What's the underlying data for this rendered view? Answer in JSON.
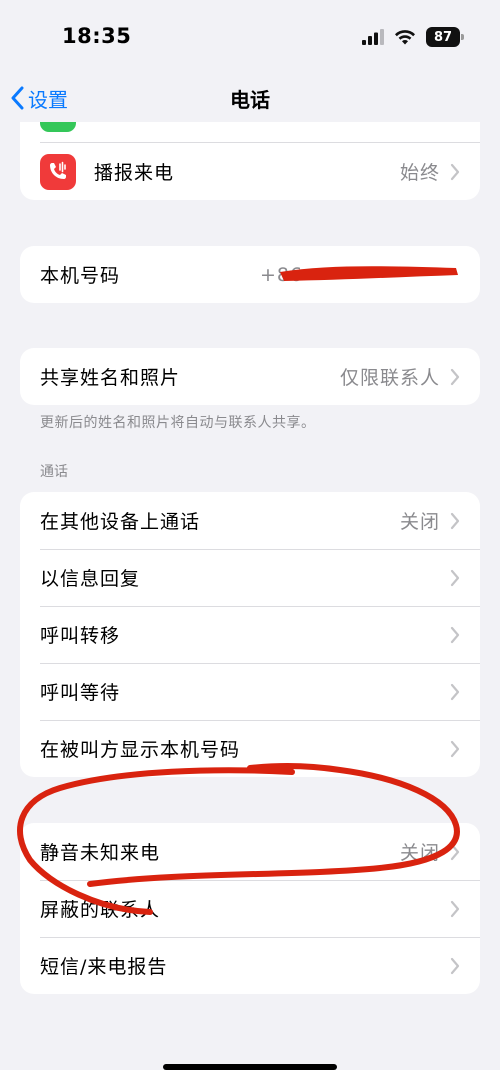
{
  "status": {
    "time": "18:35",
    "battery": "87"
  },
  "nav": {
    "back_label": "设置",
    "title": "电话"
  },
  "top_card": {
    "announce_label": "播报来电",
    "announce_value": "始终"
  },
  "number_card": {
    "label": "本机号码",
    "value": "+86"
  },
  "share_card": {
    "label": "共享姓名和照片",
    "value": "仅限联系人",
    "footer": "更新后的姓名和照片将自动与联系人共享。"
  },
  "calls_section": {
    "header": "通话",
    "items": [
      {
        "label": "在其他设备上通话",
        "value": "关闭"
      },
      {
        "label": "以信息回复",
        "value": ""
      },
      {
        "label": "呼叫转移",
        "value": ""
      },
      {
        "label": "呼叫等待",
        "value": ""
      },
      {
        "label": "在被叫方显示本机号码",
        "value": ""
      }
    ]
  },
  "block_section": {
    "items": [
      {
        "label": "静音未知来电",
        "value": "关闭"
      },
      {
        "label": "屏蔽的联系人",
        "value": ""
      },
      {
        "label": "短信/来电报告",
        "value": ""
      }
    ]
  },
  "colors": {
    "accent": "#0a7aff",
    "icon_red": "#f03a3a",
    "annotation_red": "#d9230f",
    "background": "#f2f2f6"
  }
}
